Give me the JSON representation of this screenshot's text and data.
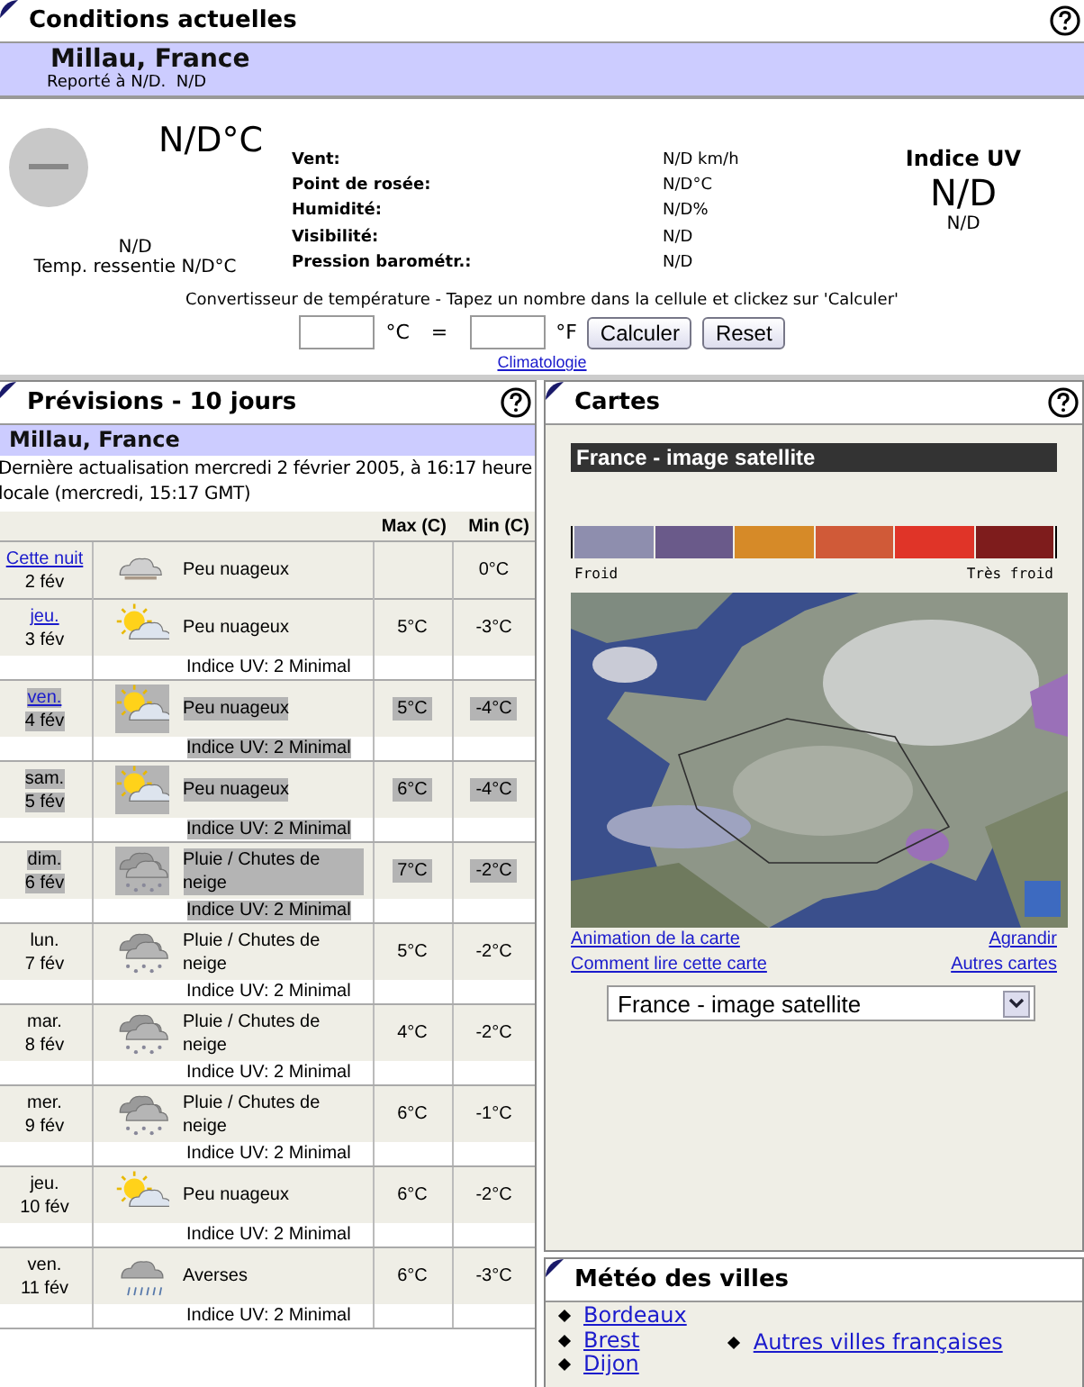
{
  "current": {
    "title": "Conditions actuelles",
    "location": "Millau, France",
    "reported": "Reporté à N/D.  N/D",
    "temperature": "N/D°C",
    "condition": "N/D",
    "feels_like": "Temp. ressentie N/D°C",
    "details": [
      {
        "label": "Vent:",
        "value": "N/D km/h"
      },
      {
        "label": "Point de rosée:",
        "value": "N/D°C"
      },
      {
        "label": "Humidité:",
        "value": "N/D%"
      },
      {
        "label": "Visibilité:",
        "value": "N/D"
      },
      {
        "label": "Pression barométr.:",
        "value": "N/D"
      }
    ],
    "uv": {
      "title": "Indice UV",
      "value": "N/D",
      "text": "N/D"
    },
    "converter": {
      "instructions": "Convertisseur de température - Tapez un nombre dans la cellule et clickez sur 'Calculer'",
      "celsius_unit": "°C",
      "equals": "=",
      "fahrenheit_unit": "°F",
      "buttons": [
        "Calculer",
        "Reset"
      ]
    },
    "link": "Climatologie"
  },
  "forecast": {
    "title": "Prévisions - 10 jours",
    "location": "Millau, France",
    "updated": "Dernière actualisation mercredi 2 février 2005, à 16:17 heure locale (mercredi, 15:17 GMT)",
    "columns": [
      "Max (C)",
      "Min (C)"
    ],
    "rows": [
      {
        "day": "Cette nuit",
        "date": "2 fév",
        "link": true,
        "kind": "cloud",
        "condition": "Peu nuageux",
        "min": "0°C",
        "selected": false
      },
      {
        "day": "jeu.",
        "date": "3 fév",
        "link": true,
        "kind": "sun-cloud",
        "condition": "Peu nuageux",
        "max": "5°C",
        "min": "-3°C",
        "uv": "Indice UV: 2 Minimal",
        "selected": false
      },
      {
        "day": "ven.",
        "date": "4 fév",
        "link": true,
        "kind": "sun-cloud",
        "condition": "Peu nuageux",
        "max": "5°C",
        "min": "-4°C",
        "uv": "Indice UV: 2 Minimal",
        "selected": true
      },
      {
        "day": "sam.",
        "date": "5 fév",
        "link": false,
        "kind": "sun-cloud",
        "condition": "Peu nuageux",
        "max": "6°C",
        "min": "-4°C",
        "uv": "Indice UV: 2 Minimal",
        "selected": true
      },
      {
        "day": "dim.",
        "date": "6 fév",
        "link": false,
        "kind": "rain-snow",
        "condition": "Pluie / Chutes de neige",
        "max": "7°C",
        "min": "-2°C",
        "uv": "Indice UV: 2 Minimal",
        "selected": true
      },
      {
        "day": "lun.",
        "date": "7 fév",
        "link": false,
        "kind": "rain-snow",
        "condition": "Pluie / Chutes de neige",
        "max": "5°C",
        "min": "-2°C",
        "uv": "Indice UV: 2 Minimal",
        "selected": false
      },
      {
        "day": "mar.",
        "date": "8 fév",
        "link": false,
        "kind": "rain-snow",
        "condition": "Pluie / Chutes de neige",
        "max": "4°C",
        "min": "-2°C",
        "uv": "Indice UV: 2 Minimal",
        "selected": false
      },
      {
        "day": "mer.",
        "date": "9 fév",
        "link": false,
        "kind": "rain-snow",
        "condition": "Pluie / Chutes de neige",
        "max": "6°C",
        "min": "-1°C",
        "uv": "Indice UV: 2 Minimal",
        "selected": false
      },
      {
        "day": "jeu.",
        "date": "10 fév",
        "link": false,
        "kind": "sun-cloud",
        "condition": "Peu nuageux",
        "max": "6°C",
        "min": "-2°C",
        "uv": "Indice UV: 2 Minimal",
        "selected": false
      },
      {
        "day": "ven.",
        "date": "11 fév",
        "link": false,
        "kind": "showers",
        "condition": "Averses",
        "max": "6°C",
        "min": "-3°C",
        "uv": "Indice UV: 2 Minimal",
        "selected": false
      }
    ]
  },
  "maps": {
    "title": "Cartes",
    "map_title": "France - image satellite",
    "legend": [
      {
        "color": "#8e8eae"
      },
      {
        "color": "#6a5a8a"
      },
      {
        "color": "#d68a28"
      },
      {
        "color": "#d05a38"
      },
      {
        "color": "#e03428"
      },
      {
        "color": "#7e1c1c"
      }
    ],
    "legend_labels": [
      "Froid",
      "Très froid"
    ],
    "links_left": [
      "Animation de la carte",
      "Comment lire cette carte"
    ],
    "links_right": [
      "Agrandir",
      "Autres cartes"
    ],
    "dropdown": "France - image satellite"
  },
  "cities": {
    "title": "Météo des villes",
    "items": [
      "Bordeaux",
      "Brest",
      "Dijon"
    ],
    "other": "Autres villes françaises"
  }
}
